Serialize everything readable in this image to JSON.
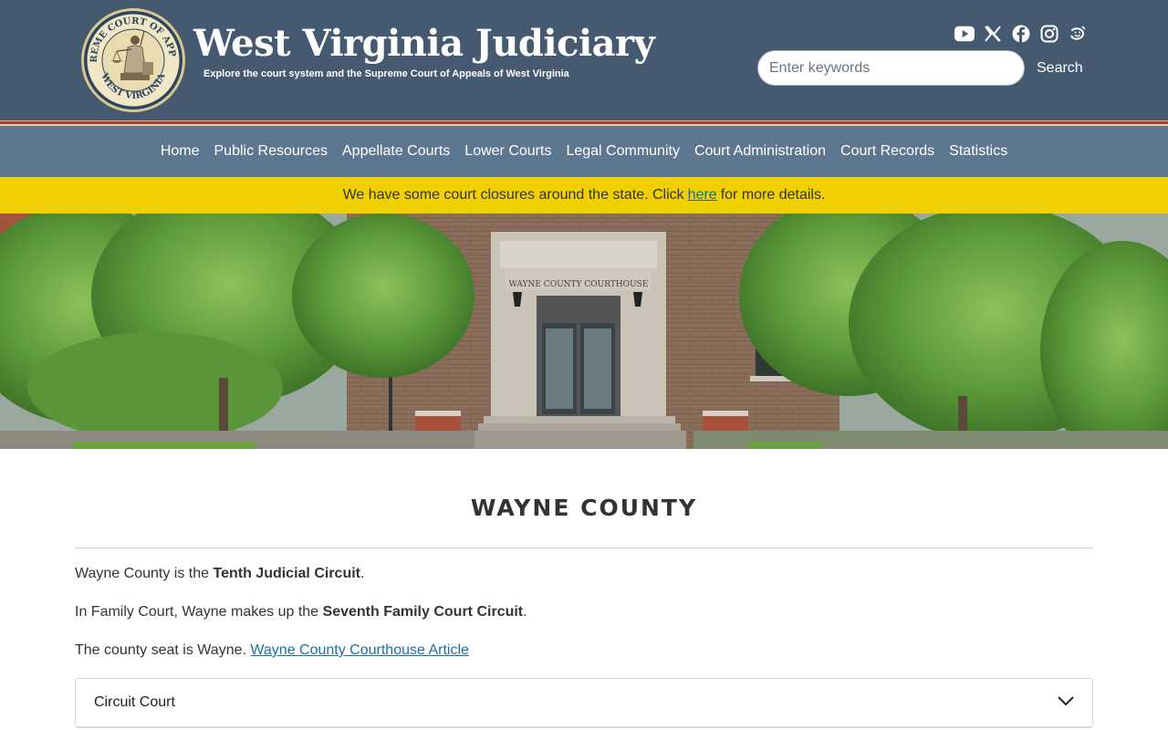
{
  "header": {
    "seal_text_top": "SUPREME COURT OF APPEALS",
    "seal_text_bottom": "WEST VIRGINIA",
    "title": "West Virginia Judiciary",
    "tagline": "Explore the court system and the Supreme Court of Appeals of West Virginia",
    "social_icons": [
      "youtube-icon",
      "x-icon",
      "facebook-icon",
      "instagram-icon",
      "threads-icon"
    ],
    "search": {
      "placeholder": "Enter keywords",
      "value": "",
      "button": "Search"
    }
  },
  "nav": {
    "items": [
      "Home",
      "Public Resources",
      "Appellate Courts",
      "Lower Courts",
      "Legal Community",
      "Court Administration",
      "Court Records",
      "Statistics"
    ]
  },
  "alert": {
    "before": "We have some court closures around the state. Click",
    "link": "here",
    "after": "for more details."
  },
  "hero": {
    "building_sign": "WAYNE COUNTY COURTHOUSE"
  },
  "main": {
    "title": "WAYNE COUNTY",
    "p1_before": "Wayne County is the ",
    "p1_bold": "Tenth Judicial Circuit",
    "p1_after": ".",
    "p2_before": "In Family Court, Wayne makes up the ",
    "p2_bold": "Seventh Family Court Circuit",
    "p2_after": ".",
    "p3_before": "The county seat is Wayne. ",
    "p3_link": "Wayne County Courthouse Article",
    "accordion": [
      {
        "label": "Circuit Court"
      }
    ]
  },
  "colors": {
    "header_bg": "#455a70",
    "nav_bg": "#5d7790",
    "alert_bg": "#f0d000",
    "link": "#1a6fa8",
    "accent_red": "#b83a2a"
  }
}
